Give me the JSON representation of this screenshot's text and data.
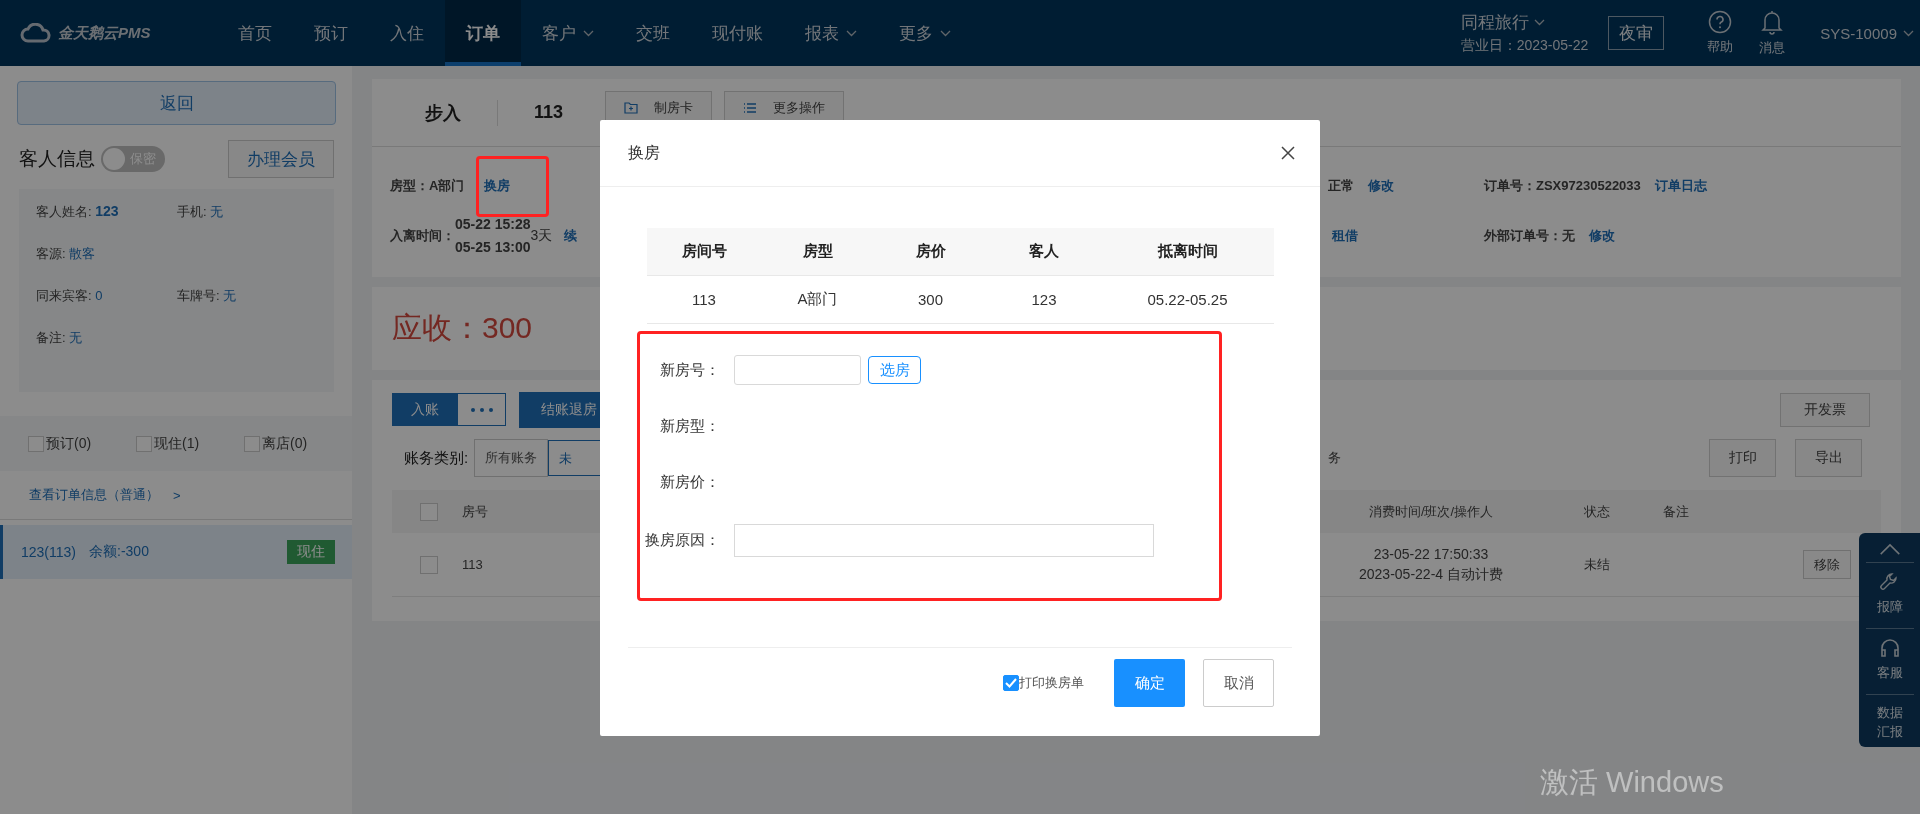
{
  "nav": {
    "logo": "金天鹅云PMS",
    "items": [
      {
        "label": "首页",
        "selected": false,
        "dropdown": false
      },
      {
        "label": "预订",
        "selected": false,
        "dropdown": false
      },
      {
        "label": "入住",
        "selected": false,
        "dropdown": false
      },
      {
        "label": "订单",
        "selected": true,
        "dropdown": false
      },
      {
        "label": "客户",
        "selected": false,
        "dropdown": true
      },
      {
        "label": "交班",
        "selected": false,
        "dropdown": false
      },
      {
        "label": "现付账",
        "selected": false,
        "dropdown": false
      },
      {
        "label": "报表",
        "selected": false,
        "dropdown": true
      },
      {
        "label": "更多",
        "selected": false,
        "dropdown": true
      }
    ],
    "hotel": "同程旅行",
    "business_date": "营业日：2023-05-22",
    "night_audit": "夜审",
    "tools": [
      {
        "label": "帮助"
      },
      {
        "label": "消息"
      }
    ],
    "user": "SYS-10009"
  },
  "sidebar": {
    "back": "返回",
    "guest_title": "客人信息",
    "privacy_toggle": {
      "label": "保密",
      "on": false
    },
    "member_button": "办理会员",
    "guest_rows": [
      [
        {
          "label": "客人姓名:",
          "value": "123",
          "bold": true
        },
        {
          "label": "手机:",
          "value": "无",
          "bold": false
        }
      ],
      [
        {
          "label": "客源:",
          "value": "散客",
          "bold": false
        }
      ],
      [
        {
          "label": "同来宾客:",
          "value": "0",
          "bold": false
        },
        {
          "label": "车牌号:",
          "value": "无",
          "bold": false
        }
      ],
      [
        {
          "label": "备注:",
          "value": "无",
          "bold": false
        }
      ]
    ],
    "filters": [
      {
        "label": "预订(0)",
        "checked": false
      },
      {
        "label": "现住(1)",
        "checked": false
      },
      {
        "label": "离店(0)",
        "checked": false
      }
    ],
    "order_link": "查看订单信息（普通）",
    "order_link_arrow": ">",
    "orders": [
      {
        "name": "123(113)",
        "balance": "余额:-300",
        "tag": "现住",
        "selected": true
      }
    ]
  },
  "order": {
    "source": "步入",
    "room": "113",
    "actions": [
      "制房卡",
      "更多操作"
    ],
    "room_type_label": "房型：",
    "room_type": "A部门",
    "change_room": "换房",
    "status": "正常",
    "status_edit": "修改",
    "order_no_label": "订单号：",
    "order_no": "ZSX97230522033",
    "order_log": "订单日志",
    "stay_label": "入离时间：",
    "arrival": "05-22 15:28",
    "departure": "05-25 13:00",
    "nights": "3天",
    "extend": "续",
    "rent": "租借",
    "ext_order_label": "外部订单号：",
    "ext_order": "无",
    "ext_edit": "修改",
    "receivable": "应收：300"
  },
  "bills": {
    "post": "入账",
    "checkout": "结账退房",
    "invoice": "开发票",
    "category_label": "账务类别:",
    "categories": [
      {
        "label": "所有账务",
        "selected": false
      },
      {
        "label": "未",
        "selected": true
      }
    ],
    "category_tail": "务",
    "print": "打印",
    "export": "导出",
    "columns": [
      "房号",
      "消费时间/班次/操作人",
      "状态",
      "备注"
    ],
    "header_checked": false,
    "rows": [
      {
        "checked": false,
        "room": "113",
        "time": "23-05-22 17:50:33",
        "shift": "2023-05-22-4 自动计费",
        "status": "未结",
        "action": "移除"
      }
    ]
  },
  "side_panel": {
    "items": [
      "报障",
      "客服",
      "数据汇报"
    ]
  },
  "modal": {
    "title": "换房",
    "columns": [
      "房间号",
      "房型",
      "房价",
      "客人",
      "抵离时间"
    ],
    "rows": [
      [
        "113",
        "A部门",
        "300",
        "123",
        "05.22-05.25"
      ]
    ],
    "form": [
      {
        "label": "新房号：",
        "kind": "input_button",
        "button": "选房"
      },
      {
        "label": "新房型：",
        "kind": "text"
      },
      {
        "label": "新房价：",
        "kind": "text"
      },
      {
        "label": "换房原因：",
        "kind": "input"
      }
    ],
    "print_option": {
      "label": "打印换房单",
      "checked": true
    },
    "confirm": "确定",
    "cancel": "取消"
  },
  "os_watermark": "激活 Windows"
}
